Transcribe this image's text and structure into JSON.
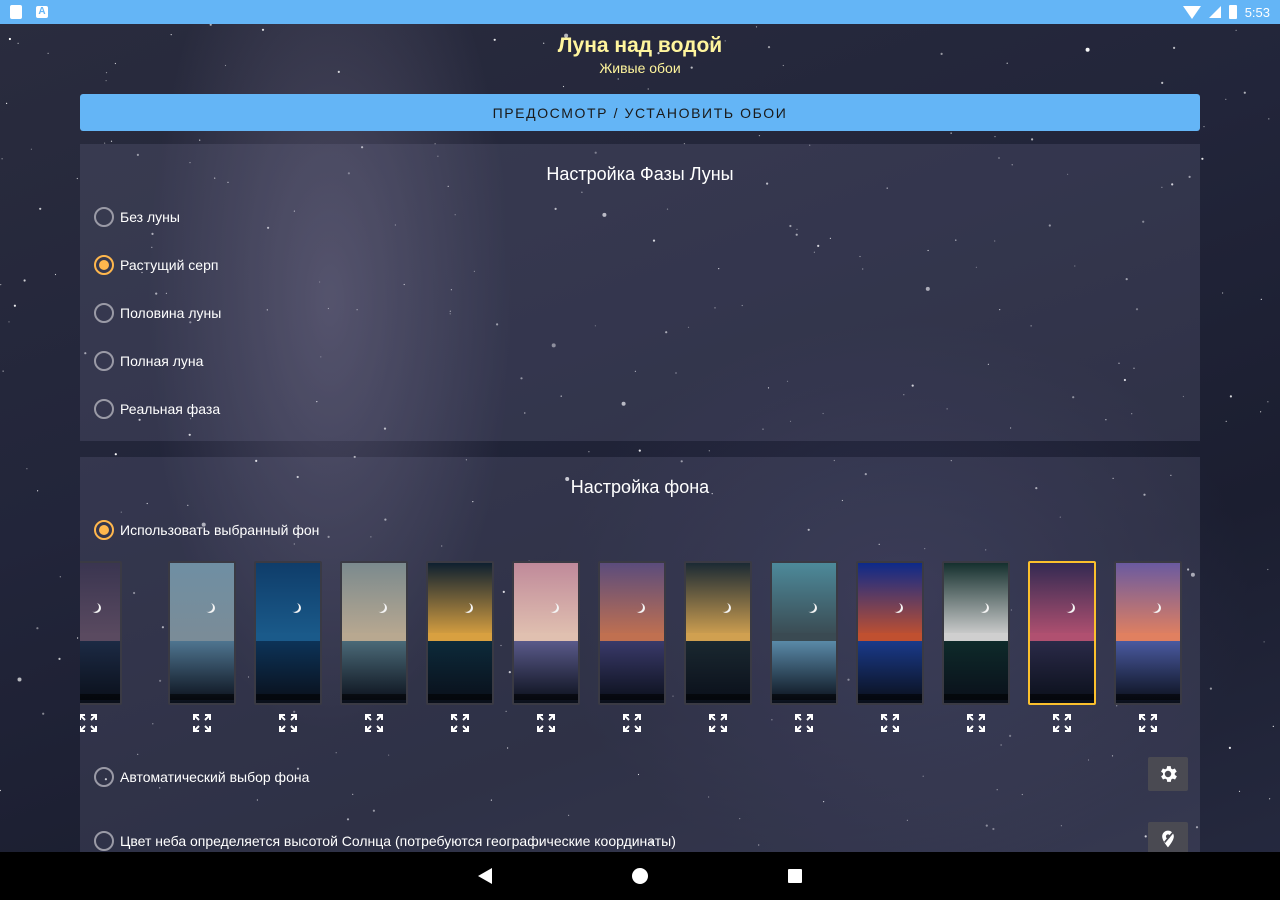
{
  "status_bar": {
    "time": "5:53"
  },
  "header": {
    "title": "Луна над водой",
    "subtitle": "Живые обои"
  },
  "preview_button": {
    "label": "ПРЕДОСМОТР / УСТАНОВИТЬ ОБОИ"
  },
  "moon_phase": {
    "title": "Настройка Фазы Луны",
    "options": [
      {
        "label": "Без луны",
        "checked": false
      },
      {
        "label": "Растущий серп",
        "checked": true
      },
      {
        "label": "Половина луны",
        "checked": false
      },
      {
        "label": "Полная луна",
        "checked": false
      },
      {
        "label": "Реальная фаза",
        "checked": false
      }
    ]
  },
  "background": {
    "title": "Настройка фона",
    "use_selected": {
      "label": "Использовать выбранный фон",
      "checked": true
    },
    "auto_select": {
      "label": "Автоматический выбор фона",
      "checked": false
    },
    "sun_height": {
      "label": "Цвет неба определяется высотой Солнца (потребуются географические координаты)",
      "checked": false
    },
    "thumbnails": [
      {
        "sky": "#3a3550",
        "water": "#1c2a44",
        "city": "#5a4a60",
        "selected": false
      },
      {
        "sky": "#6f8fa3",
        "water": "#4f7590",
        "city": "#7a8c98",
        "selected": false
      },
      {
        "sky": "#0f3d6a",
        "water": "#0c3358",
        "city": "#1a5a8a",
        "selected": false
      },
      {
        "sky": "#7b8a8e",
        "water": "#4b6a78",
        "city": "#b8a890",
        "selected": false
      },
      {
        "sky": "#0e2030",
        "water": "#0c2a3a",
        "city": "#d8a040",
        "selected": false
      },
      {
        "sky": "#c08a9a",
        "water": "#5a5a8a",
        "city": "#e0c0b0",
        "selected": false
      },
      {
        "sky": "#5b4c7c",
        "water": "#3a3a6a",
        "city": "#c07050",
        "selected": false
      },
      {
        "sky": "#1b2a34",
        "water": "#1a2830",
        "city": "#d0a050",
        "selected": false
      },
      {
        "sky": "#4d8a9a",
        "water": "#5a8aa8",
        "city": "#3a4a52",
        "selected": false
      },
      {
        "sky": "#0d2a8a",
        "water": "#1a3a8a",
        "city": "#c05030",
        "selected": false
      },
      {
        "sky": "#15302e",
        "water": "#0e2a2a",
        "city": "#cfcfcf",
        "selected": false
      },
      {
        "sky": "#332a52",
        "water": "#2a2a48",
        "city": "#b05070",
        "selected": true
      },
      {
        "sky": "#6a5aa0",
        "water": "#4a5aa0",
        "city": "#e08060",
        "selected": false
      }
    ]
  },
  "icons": {
    "settings": "gear-icon",
    "location": "location-icon",
    "expand": "fullscreen-icon"
  },
  "colors": {
    "accent": "#64b5f6",
    "radio_checked": "#ffb74d",
    "title": "#fff59d",
    "selected_border": "#fbc02d"
  }
}
